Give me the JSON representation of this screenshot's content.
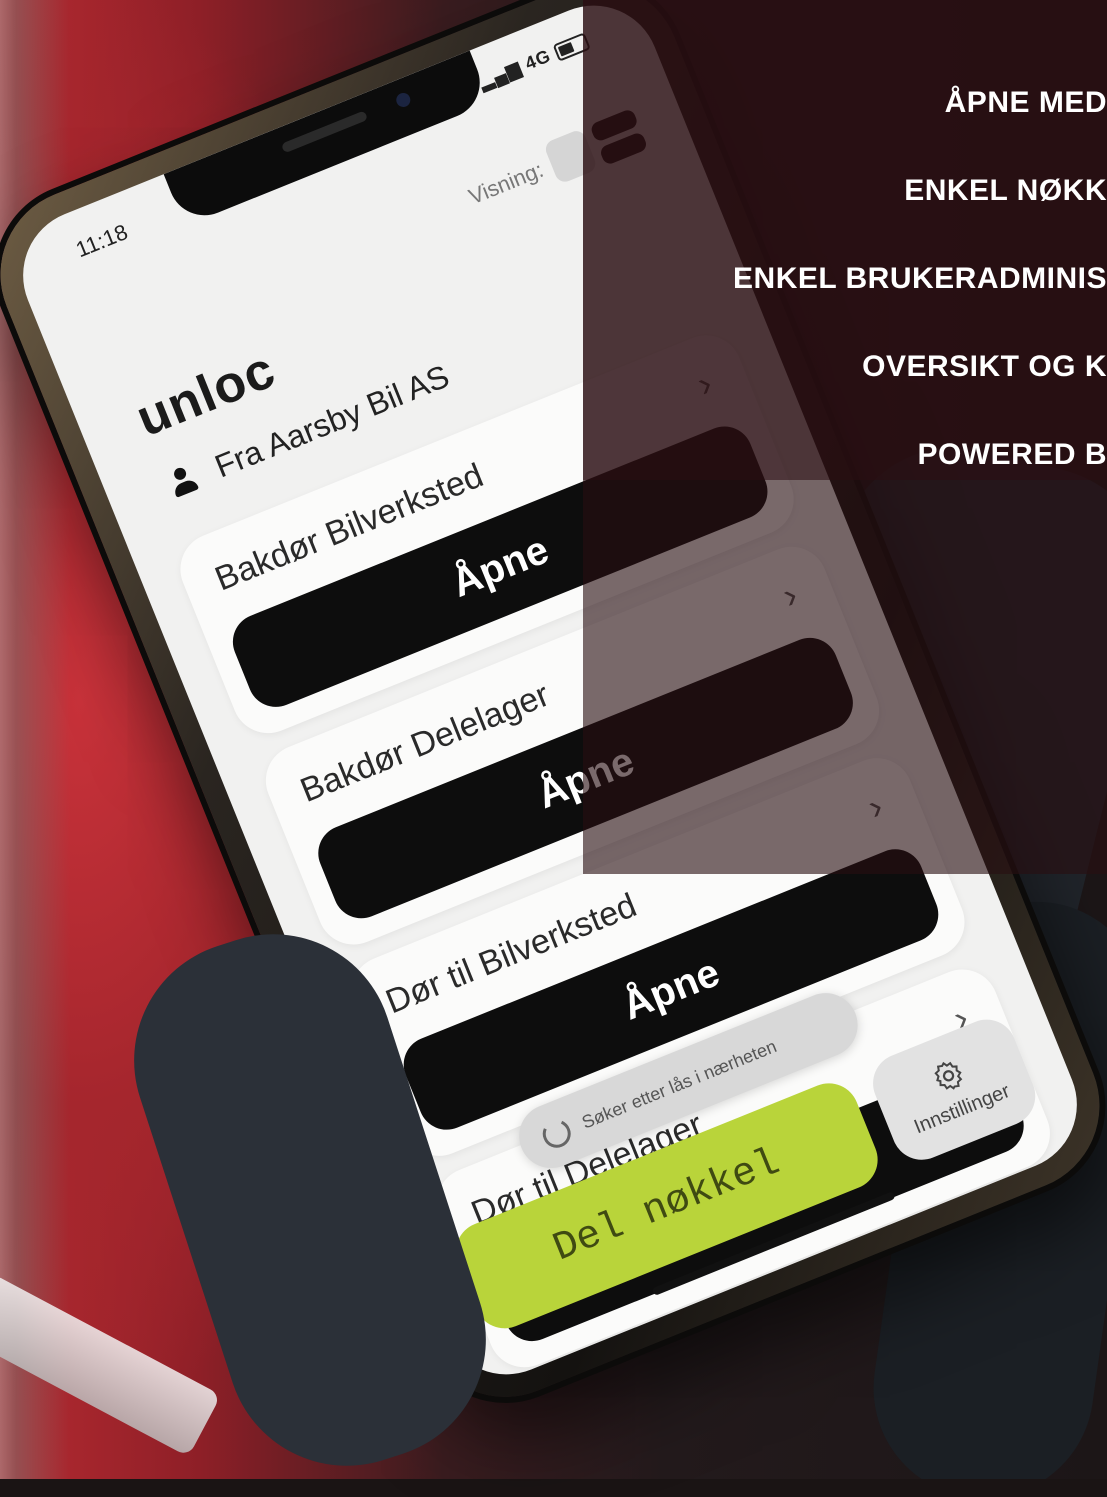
{
  "headlines": [
    "ÅPNE MED",
    "ENKEL NØKK",
    "ENKEL BRUKERADMINIS",
    "OVERSIKT OG K",
    "POWERED B"
  ],
  "phone": {
    "status": {
      "time": "11:18",
      "network": "4G"
    },
    "view_label": "Visning:",
    "brand": "unloc",
    "owner": "Fra Aarsby Bil AS",
    "locks": [
      {
        "name": "Bakdør Bilverksted",
        "button": "Åpne"
      },
      {
        "name": "Bakdør Delelager",
        "button": "Åpne"
      },
      {
        "name": "Dør til Bilverksted",
        "button": "Åpne"
      },
      {
        "name": "Dør til Delelager",
        "button": ""
      }
    ],
    "scanning_text": "Søker etter lås i nærheten",
    "share_button": "Del nøkkel",
    "settings_label": "Innstillinger"
  },
  "colors": {
    "accent_green": "#b9d43a",
    "door_red": "#b52a31",
    "overlay": "#3a1016"
  }
}
